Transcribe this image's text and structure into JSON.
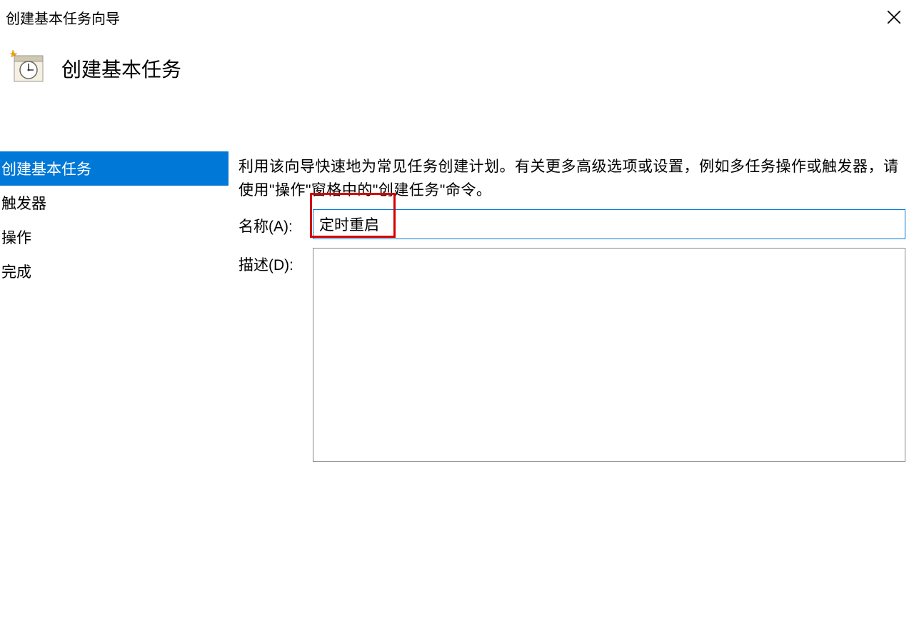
{
  "titlebar": {
    "title": "创建基本任务向导"
  },
  "header": {
    "heading": "创建基本任务"
  },
  "sidebar": {
    "items": [
      {
        "label": "创建基本任务",
        "active": true
      },
      {
        "label": "触发器",
        "active": false
      },
      {
        "label": "操作",
        "active": false
      },
      {
        "label": "完成",
        "active": false
      }
    ]
  },
  "main": {
    "description": "利用该向导快速地为常见任务创建计划。有关更多高级选项或设置，例如多任务操作或触发器，请使用\"操作\"窗格中的\"创建任务\"命令。",
    "name_label": "名称(A):",
    "name_value": "定时重启",
    "desc_label": "描述(D):",
    "desc_value": ""
  }
}
